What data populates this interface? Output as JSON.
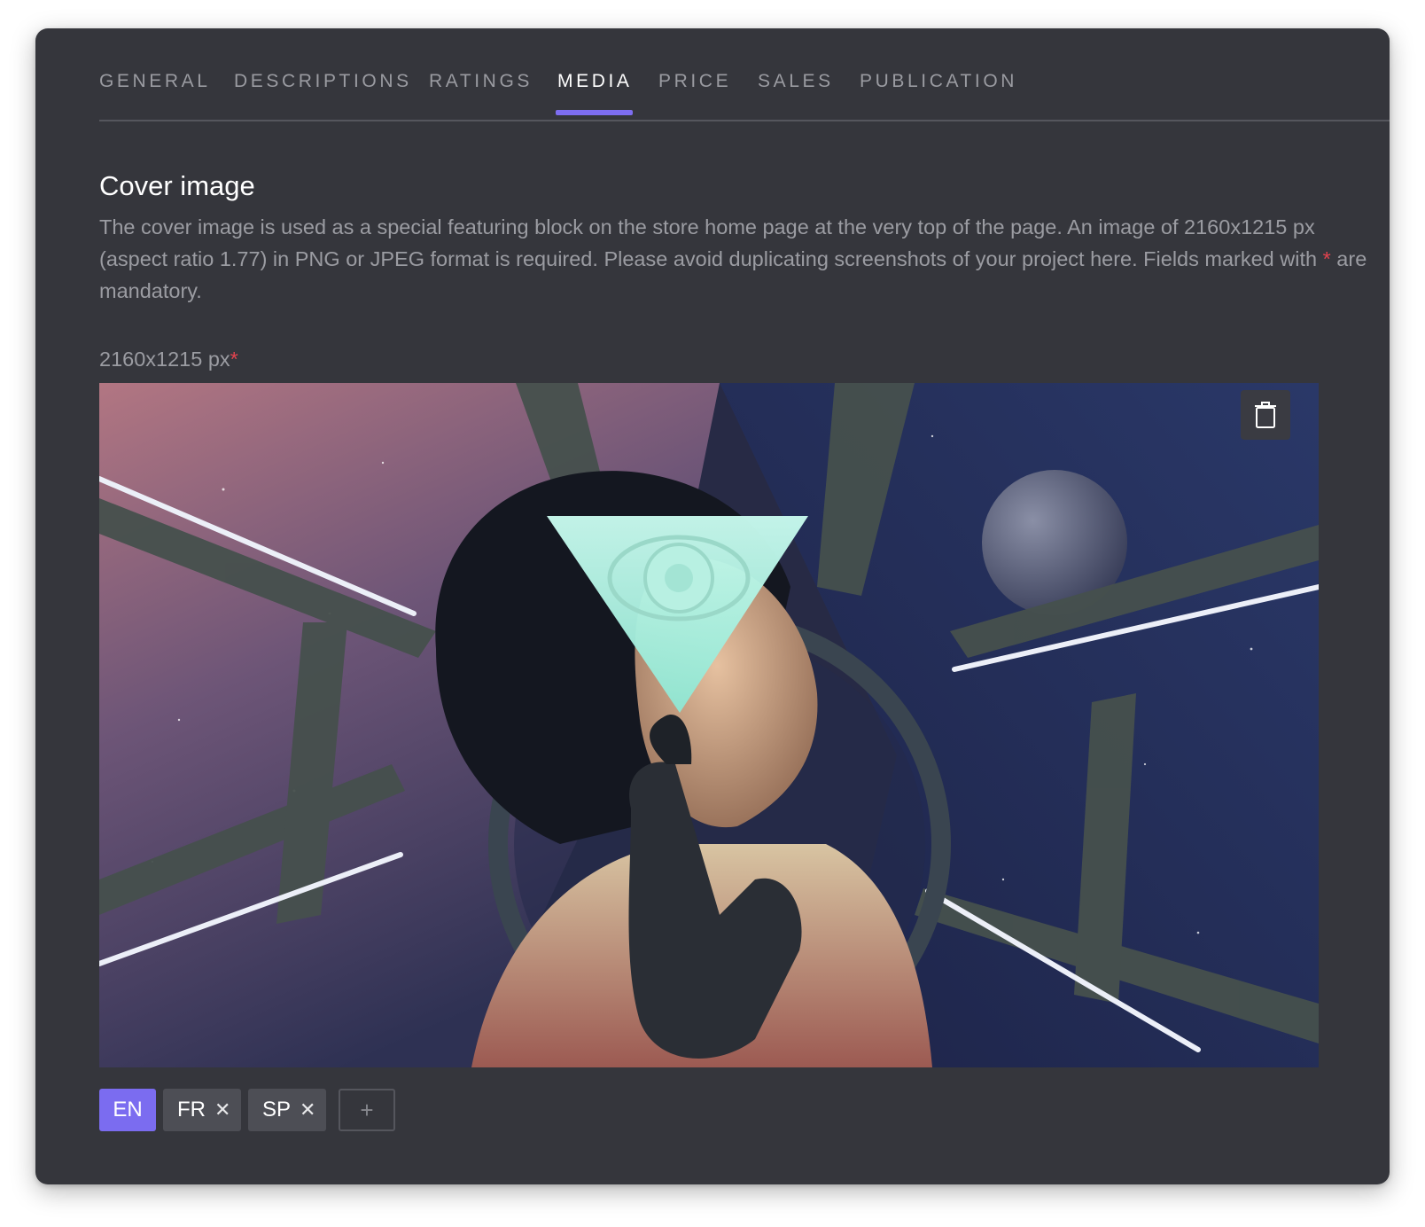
{
  "tabs": {
    "items": [
      {
        "label": "GENERAL"
      },
      {
        "label": "DESCRIPTIONS"
      },
      {
        "label": "RATINGS"
      },
      {
        "label": "MEDIA"
      },
      {
        "label": "PRICE"
      },
      {
        "label": "SALES"
      },
      {
        "label": "PUBLICATION"
      }
    ],
    "active": "MEDIA"
  },
  "cover_section": {
    "title": "Cover image",
    "description_part1": "The cover image is used as a special featuring block on the store home page at the very top of the page. An image of 2160x1215 px (aspect ratio 1.77) in PNG or JPEG format is required. Please avoid duplicating screenshots of your project here. Fields marked with ",
    "required_marker": "*",
    "description_part2": " are mandatory.",
    "field_label": "2160x1215 px",
    "delete_icon": "trash-icon"
  },
  "languages": {
    "items": [
      {
        "code": "EN",
        "removable": false
      },
      {
        "code": "FR",
        "removable": true,
        "remove_symbol": "✕"
      },
      {
        "code": "SP",
        "removable": true,
        "remove_symbol": "✕"
      }
    ],
    "active": "EN",
    "add_symbol": "+"
  },
  "colors": {
    "panel_bg": "#35363c",
    "accent": "#7b6cf0",
    "required": "#e2434e",
    "muted_text": "#9b9ca2"
  }
}
